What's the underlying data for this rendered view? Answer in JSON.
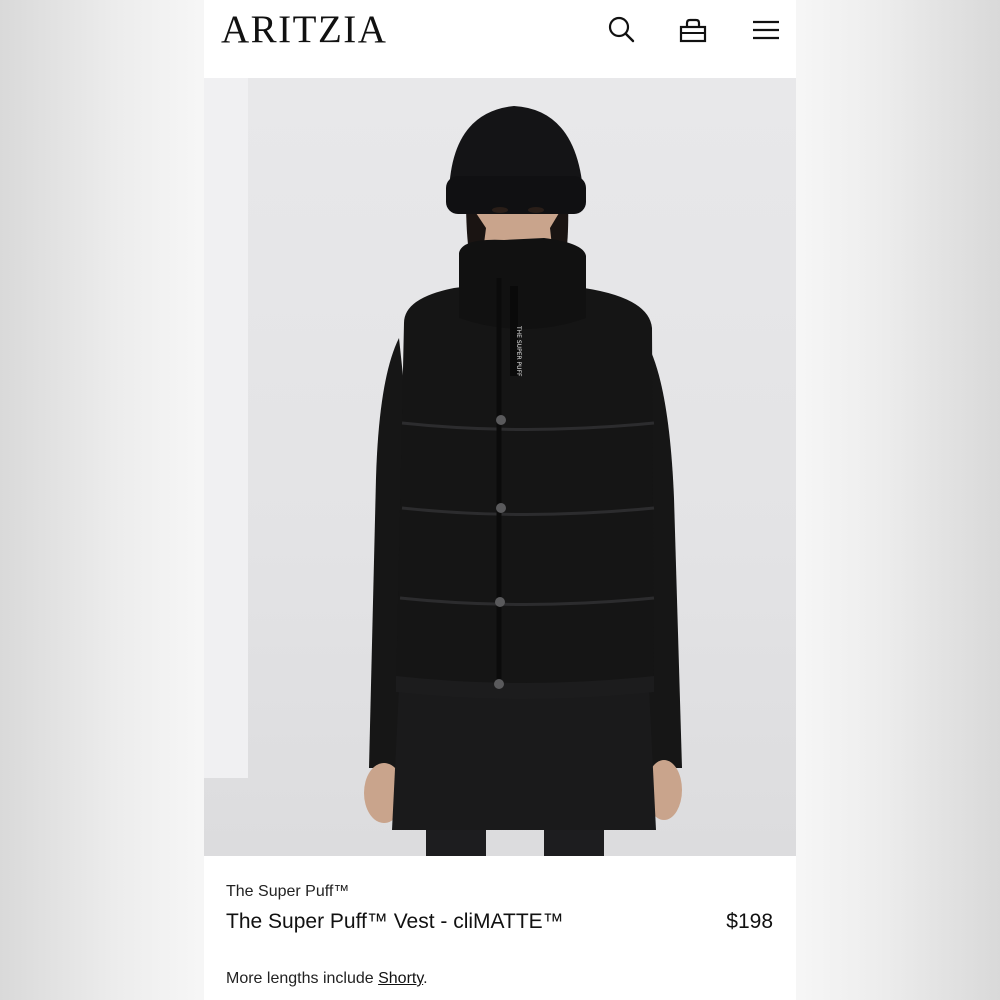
{
  "header": {
    "brand": "ARITZIA",
    "icons": [
      "search-icon",
      "bag-icon",
      "menu-icon"
    ]
  },
  "product": {
    "collection": "The Super Puff™",
    "name": "The Super Puff™ Vest - cliMATTE™",
    "price": "$198",
    "more_lengths_prefix": "More lengths include ",
    "more_lengths_link": "Shorty",
    "more_lengths_suffix": "."
  },
  "image": {
    "zipper_tape_text": "THE SUPER PUFF",
    "colors": {
      "backdrop": "#e4e4e6",
      "garment": "#151515",
      "skin": "#c9a48c"
    }
  }
}
